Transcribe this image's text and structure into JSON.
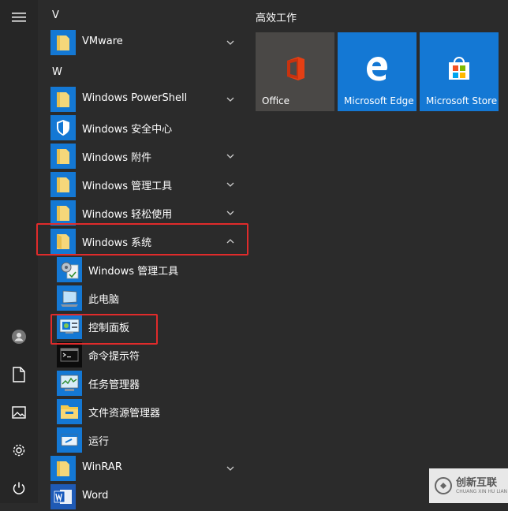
{
  "headers": {
    "v": "V",
    "w": "W"
  },
  "apps": {
    "vmware": "VMware",
    "powershell": "Windows PowerShell",
    "security": "Windows 安全中心",
    "accessories": "Windows 附件",
    "admin_tools_folder": "Windows 管理工具",
    "ease_of_access": "Windows 轻松使用",
    "system_folder": "Windows 系统",
    "admin_tools": "Windows 管理工具",
    "this_pc": "此电脑",
    "control_panel": "控制面板",
    "cmd": "命令提示符",
    "task_manager": "任务管理器",
    "explorer": "文件资源管理器",
    "run": "运行",
    "winrar": "WinRAR",
    "word": "Word"
  },
  "tiles": {
    "group_title": "高效工作",
    "office": "Office",
    "edge": "Microsoft Edge",
    "store": "Microsoft Store"
  },
  "watermark": {
    "brand": "创新互联",
    "sub": "CHUANG XIN HU LIAN"
  },
  "colors": {
    "background": "#2b2b2b",
    "tile_blue": "#1478d4",
    "office_tile": "#4a4846",
    "highlight": "#e02b2b"
  }
}
